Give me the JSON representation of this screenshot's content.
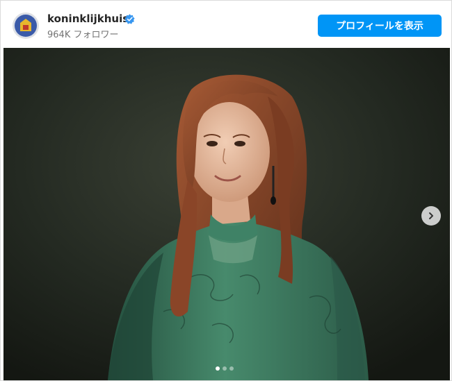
{
  "header": {
    "username": "koninklijkhuis",
    "verified": true,
    "followers": "964K フォロワー",
    "profile_button_label": "プロフィールを表示"
  },
  "carousel": {
    "slide_count": 3,
    "current_slide": 1
  },
  "colors": {
    "accent": "#0095f6",
    "verified_badge": "#3897f0",
    "photo_background": "#1e221c",
    "dress": "#3b7a60",
    "hair": "#8b4a2c"
  },
  "icons": {
    "verified": "verified-badge-icon",
    "next": "chevron-right-icon"
  }
}
